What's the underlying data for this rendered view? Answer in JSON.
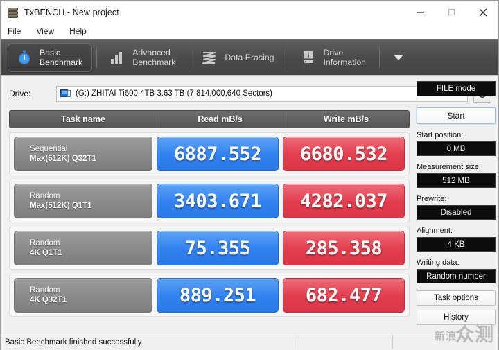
{
  "window": {
    "title": "TxBENCH - New project",
    "app_icon": "disk-stack-icon",
    "minimize": "—",
    "maximize": "□",
    "close": "✕"
  },
  "menu": {
    "items": [
      {
        "label": "File"
      },
      {
        "label": "View"
      },
      {
        "label": "Help"
      }
    ]
  },
  "tabs": [
    {
      "label": "Basic\nBenchmark",
      "icon": "stopwatch-icon",
      "active": true
    },
    {
      "label": "Advanced\nBenchmark",
      "icon": "bar-chart-icon",
      "active": false
    },
    {
      "label": "Data Erasing",
      "icon": "wave-lines-icon",
      "active": false
    },
    {
      "label": "Drive\nInformation",
      "icon": "drive-info-icon",
      "active": false
    }
  ],
  "tab_overflow": "chevron-down-icon",
  "drive": {
    "label": "Drive:",
    "value": "(G:) ZHITAI Ti600 4TB  3.63 TB (7,814,000,640 Sectors)",
    "icon": "drive-monitor-icon",
    "dropdown_icon": "chevron-down-icon",
    "refresh_icon": "refresh-icon"
  },
  "table": {
    "headers": [
      "Task name",
      "Read mB/s",
      "Write mB/s"
    ],
    "rows": [
      {
        "task_line1": "Sequential",
        "task_line2": "Max(512K) Q32T1",
        "read": "6887.552",
        "write": "6680.532"
      },
      {
        "task_line1": "Random",
        "task_line2": "Max(512K) Q1T1",
        "read": "3403.671",
        "write": "4282.037"
      },
      {
        "task_line1": "Random",
        "task_line2": "4K Q1T1",
        "read": "75.355",
        "write": "285.358"
      },
      {
        "task_line1": "Random",
        "task_line2": "4K Q32T1",
        "read": "889.251",
        "write": "682.477"
      }
    ]
  },
  "sidebar": {
    "mode": "FILE mode",
    "start": "Start",
    "start_position_label": "Start position:",
    "start_position_value": "0 MB",
    "measurement_size_label": "Measurement size:",
    "measurement_size_value": "512 MB",
    "prewrite_label": "Prewrite:",
    "prewrite_value": "Disabled",
    "alignment_label": "Alignment:",
    "alignment_value": "4 KB",
    "writing_data_label": "Writing data:",
    "writing_data_value": "Random number",
    "task_options": "Task options",
    "history": "History"
  },
  "statusbar": {
    "message": "Basic Benchmark finished successfully.",
    "pane2": "",
    "pane3": ""
  },
  "watermark": {
    "text_small": "新浪",
    "text_large": "众测"
  },
  "colors": {
    "read_accent": "#3181ef",
    "write_accent": "#e23d4d",
    "tabstrip_bg": "#4a4a4a",
    "field_bg": "#0c0c0c"
  }
}
